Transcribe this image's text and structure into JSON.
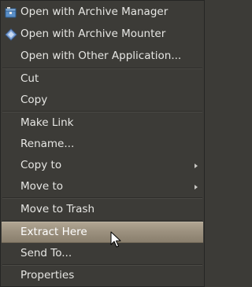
{
  "menu": {
    "items": [
      {
        "label": "Open with Archive Manager",
        "icon": "archive-manager-icon"
      },
      {
        "label": "Open with Archive Mounter",
        "icon": "archive-mounter-icon"
      },
      {
        "label": "Open with Other Application..."
      },
      {
        "label": "Cut"
      },
      {
        "label": "Copy"
      },
      {
        "label": "Make Link"
      },
      {
        "label": "Rename..."
      },
      {
        "label": "Copy to",
        "submenu": true
      },
      {
        "label": "Move to",
        "submenu": true
      },
      {
        "label": "Move to Trash"
      },
      {
        "label": "Extract Here",
        "highlighted": true
      },
      {
        "label": "Send To..."
      },
      {
        "label": "Properties"
      }
    ]
  },
  "colors": {
    "menu_background": "#3c3b37",
    "menu_text": "#e6e6e3",
    "highlight": "#9c917f"
  }
}
